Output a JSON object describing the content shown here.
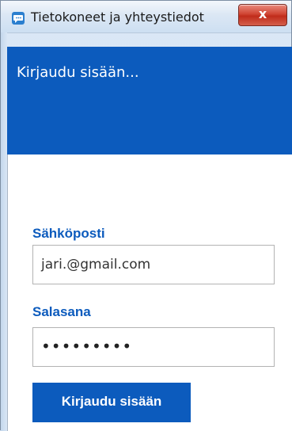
{
  "window": {
    "title": "Tietokoneet ja yhteystiedot",
    "close_label": "x"
  },
  "header": {
    "text": "Kirjaudu sisään..."
  },
  "form": {
    "email_label": "Sähköposti",
    "email_value": "jari.@gmail.com",
    "password_label": "Salasana",
    "password_value": "•••••••••",
    "submit_label": "Kirjaudu sisään"
  },
  "colors": {
    "accent": "#0c5bbd",
    "close_button": "#c8382a"
  },
  "icons": {
    "app": "app-chat-icon",
    "close": "close-icon"
  }
}
